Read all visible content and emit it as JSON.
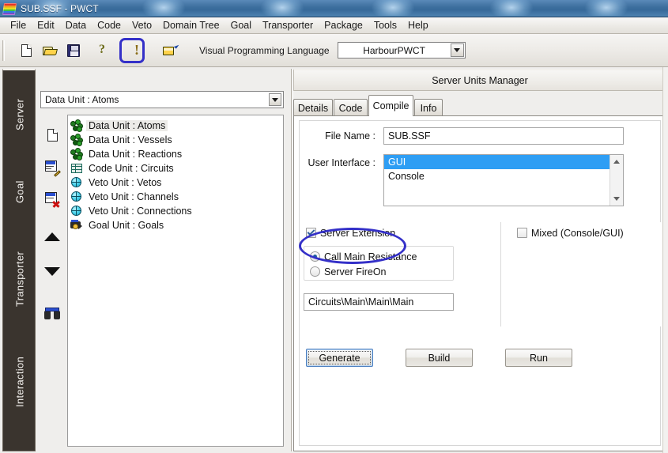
{
  "window": {
    "title": "SUB.SSF  - PWCT",
    "app_icon": "pwct-logo-icon"
  },
  "menubar": {
    "items": [
      {
        "label": "File"
      },
      {
        "label": "Edit"
      },
      {
        "label": "Data"
      },
      {
        "label": "Code"
      },
      {
        "label": "Veto"
      },
      {
        "label": "Domain Tree"
      },
      {
        "label": "Goal"
      },
      {
        "label": "Transporter"
      },
      {
        "label": "Package"
      },
      {
        "label": "Tools"
      },
      {
        "label": "Help"
      }
    ]
  },
  "toolbar": {
    "buttons": [
      {
        "name": "new-file-button",
        "icon": "new-document-icon"
      },
      {
        "name": "open-file-button",
        "icon": "open-folder-icon"
      },
      {
        "name": "save-file-button",
        "icon": "floppy-disk-save-icon"
      },
      {
        "name": "help-button",
        "icon": "question-mark-icon"
      },
      {
        "name": "warning-button",
        "icon": "exclamation-mark-icon",
        "annotated": true
      },
      {
        "name": "open-external-button",
        "icon": "folder-arrow-icon"
      }
    ],
    "language_label": "Visual Programming Language",
    "language_value": "HarbourPWCT",
    "dropdown_icon": "chevron-down-icon"
  },
  "sidebar": {
    "tabs": [
      {
        "label": "Server"
      },
      {
        "label": "Goal"
      },
      {
        "label": "Transporter"
      },
      {
        "label": "Interaction"
      }
    ]
  },
  "left_pane": {
    "unit_selector_value": "Data Unit : Atoms",
    "unit_selector_icon": "chevron-down-icon",
    "tool_buttons": [
      {
        "name": "new-unit-button",
        "icon": "new-page-icon"
      },
      {
        "name": "edit-unit-button",
        "icon": "edit-list-icon"
      },
      {
        "name": "delete-unit-button",
        "icon": "delete-list-icon"
      },
      {
        "name": "move-up-button",
        "icon": "arrow-up-icon"
      },
      {
        "name": "move-down-button",
        "icon": "arrow-down-icon"
      },
      {
        "name": "search-unit-button",
        "icon": "binoculars-icon"
      }
    ],
    "tree_items": [
      {
        "label": "Data Unit : Atoms",
        "icon": "data-unit-icon",
        "selected": true
      },
      {
        "label": "Data Unit : Vessels",
        "icon": "data-unit-icon",
        "selected": false
      },
      {
        "label": "Data Unit : Reactions",
        "icon": "data-unit-icon",
        "selected": false
      },
      {
        "label": "Code Unit : Circuits",
        "icon": "code-unit-icon",
        "selected": false
      },
      {
        "label": "Veto Unit : Vetos",
        "icon": "veto-unit-icon",
        "selected": false
      },
      {
        "label": "Veto Unit : Channels",
        "icon": "veto-unit-icon",
        "selected": false
      },
      {
        "label": "Veto Unit : Connections",
        "icon": "veto-unit-icon",
        "selected": false
      },
      {
        "label": "Goal Unit : Goals",
        "icon": "goal-unit-icon",
        "selected": false
      }
    ]
  },
  "right_pane": {
    "header_title": "Server Units Manager",
    "tabs": [
      {
        "label": "Details",
        "active": false
      },
      {
        "label": "Code",
        "active": false
      },
      {
        "label": "Compile",
        "active": true
      },
      {
        "label": "Info",
        "active": false
      }
    ],
    "compile": {
      "file_name_label": "File Name :",
      "file_name_value": "SUB.SSF",
      "user_interface_label": "User Interface :",
      "user_interface_options": [
        {
          "label": "GUI",
          "selected": true
        },
        {
          "label": "Console",
          "selected": false
        }
      ],
      "server_extension_label": "Server Extension",
      "server_extension_checked": true,
      "server_extension_options": [
        {
          "label": "Call Main Resistance",
          "selected": true
        },
        {
          "label": "Server FireOn",
          "selected": false
        }
      ],
      "path_value": "Circuits\\Main\\Main\\Main",
      "mixed_label": "Mixed (Console/GUI)",
      "mixed_checked": false,
      "buttons": [
        {
          "label": "Generate",
          "focused": true
        },
        {
          "label": "Build",
          "focused": false
        },
        {
          "label": "Run",
          "focused": false
        }
      ]
    }
  },
  "annotations": {
    "color": "#3430c8",
    "marks": [
      {
        "target": "warning-button",
        "shape": "rounded-rect"
      },
      {
        "target": "server-extension-checkbox",
        "shape": "ellipse"
      }
    ]
  },
  "colors": {
    "titlebar_blue": "#3d6f9e",
    "selection_blue": "#2e9ef4",
    "annotation_blue": "#3430c8",
    "sidebar_dark": "#3a342e"
  }
}
